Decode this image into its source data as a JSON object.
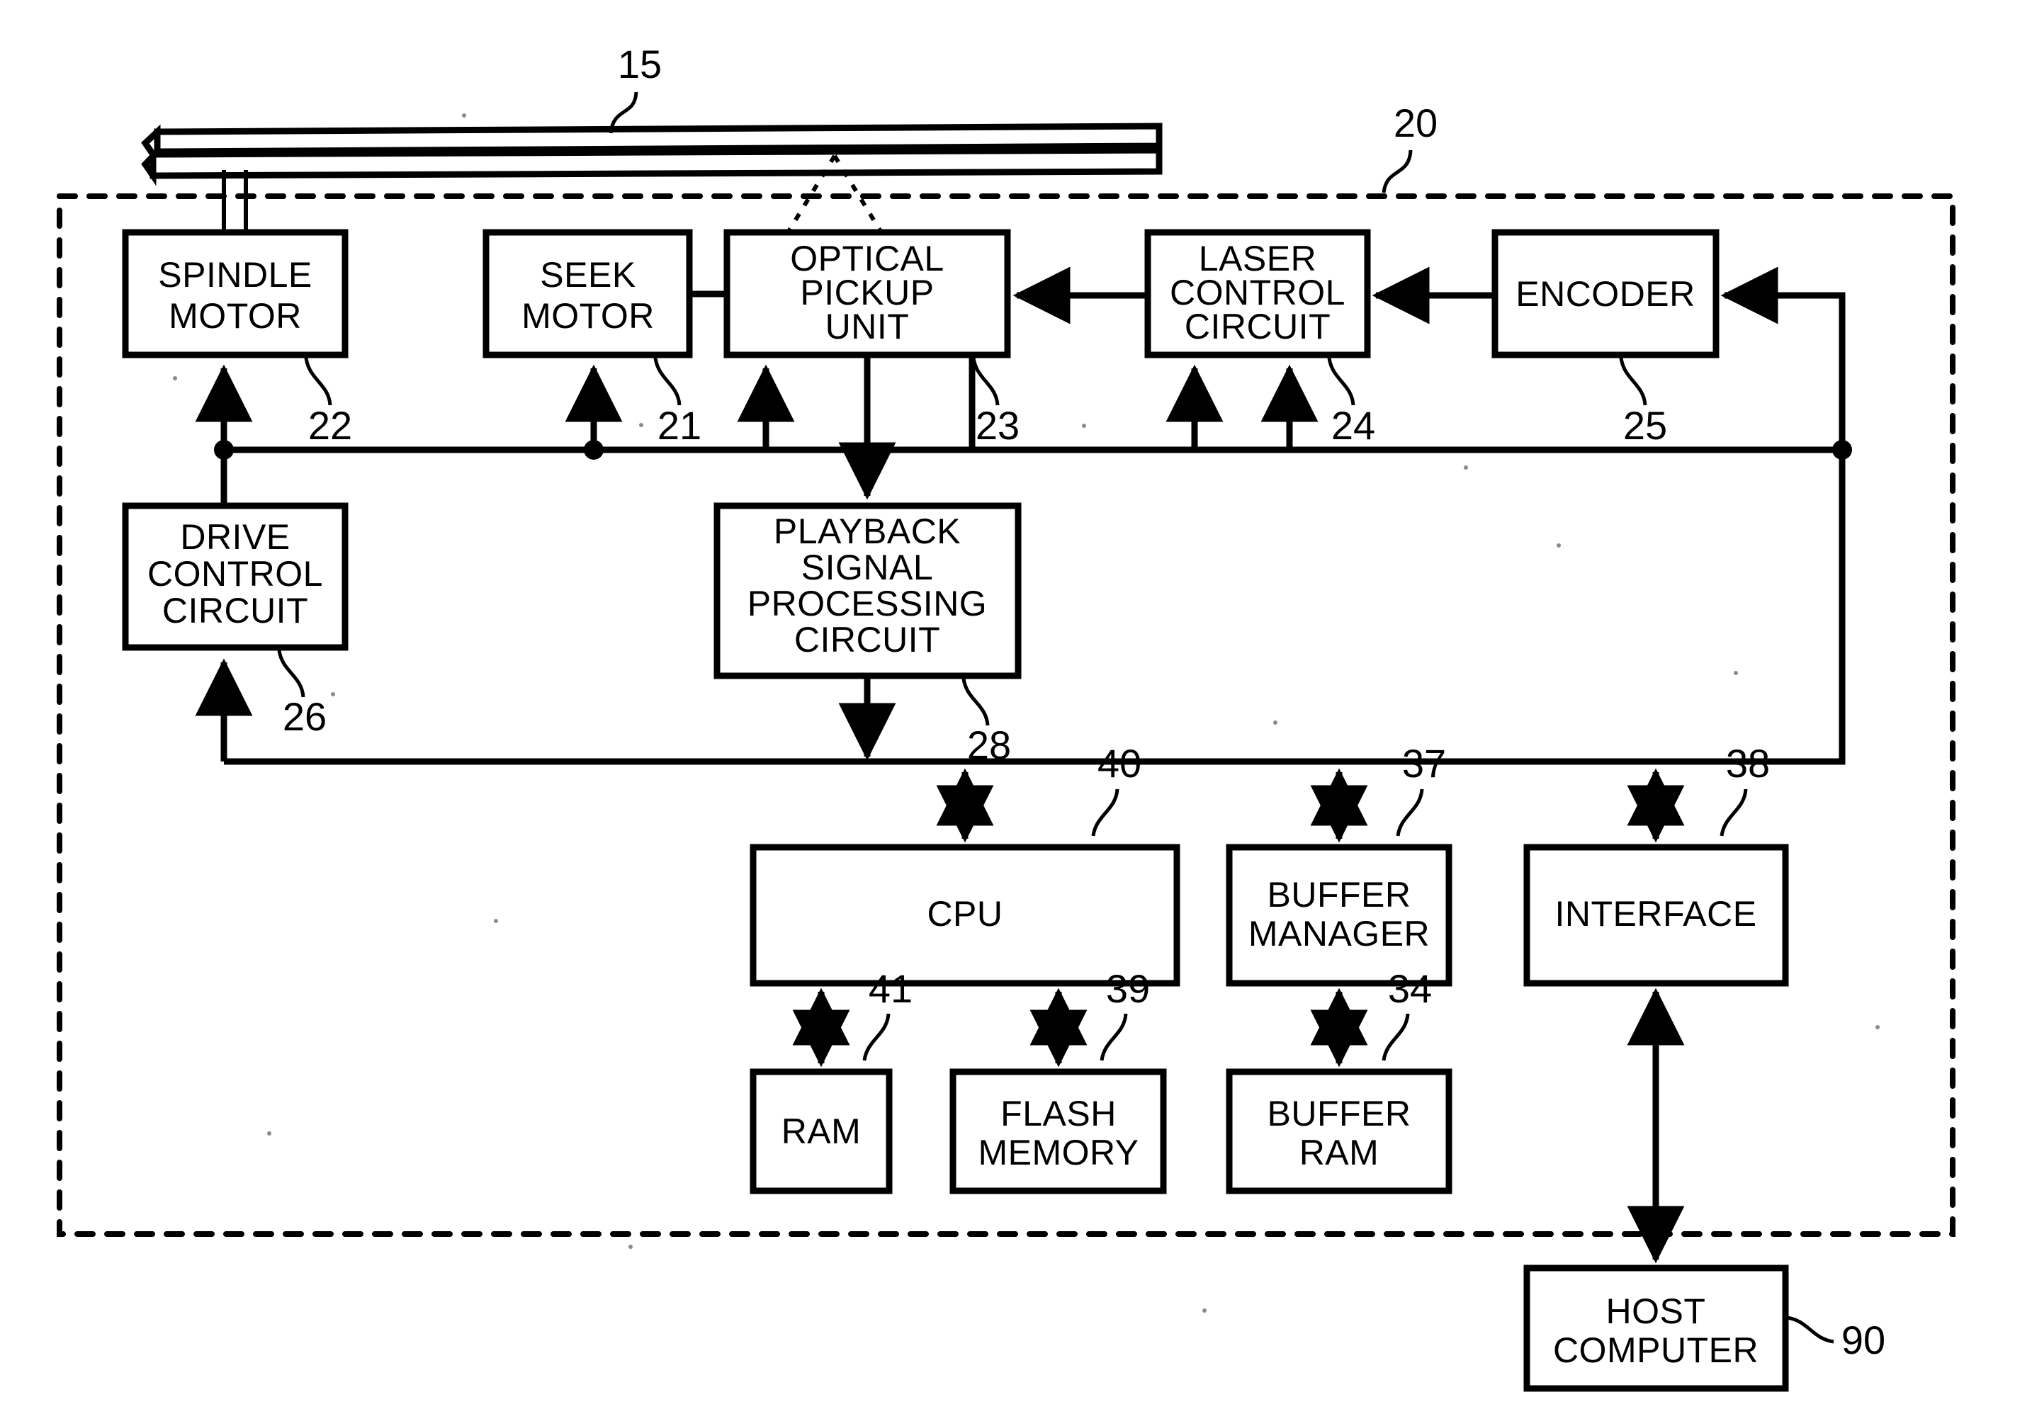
{
  "figure": {
    "type": "patent-block-diagram",
    "subject": "optical disc drive block diagram"
  },
  "blocks": [
    {
      "id": "spindle-motor",
      "lines": [
        "SPINDLE",
        "MOTOR"
      ],
      "ref": "22"
    },
    {
      "id": "seek-motor",
      "lines": [
        "SEEK",
        "MOTOR"
      ],
      "ref": "21"
    },
    {
      "id": "optical-pickup",
      "lines": [
        "OPTICAL",
        "PICKUP",
        "UNIT"
      ],
      "ref": "23"
    },
    {
      "id": "laser-control",
      "lines": [
        "LASER",
        "CONTROL",
        "CIRCUIT"
      ],
      "ref": "24"
    },
    {
      "id": "encoder",
      "lines": [
        "ENCODER"
      ],
      "ref": "25"
    },
    {
      "id": "drive-control",
      "lines": [
        "DRIVE",
        "CONTROL",
        "CIRCUIT"
      ],
      "ref": "26"
    },
    {
      "id": "playback",
      "lines": [
        "PLAYBACK",
        "SIGNAL",
        "PROCESSING",
        "CIRCUIT"
      ],
      "ref": "28"
    },
    {
      "id": "cpu",
      "lines": [
        "CPU"
      ],
      "ref": "40"
    },
    {
      "id": "buffer-manager",
      "lines": [
        "BUFFER",
        "MANAGER"
      ],
      "ref": "37"
    },
    {
      "id": "interface",
      "lines": [
        "INTERFACE"
      ],
      "ref": "38"
    },
    {
      "id": "ram",
      "lines": [
        "RAM"
      ],
      "ref": "41"
    },
    {
      "id": "flash-memory",
      "lines": [
        "FLASH",
        "MEMORY"
      ],
      "ref": "39"
    },
    {
      "id": "buffer-ram",
      "lines": [
        "BUFFER",
        "RAM"
      ],
      "ref": "34"
    },
    {
      "id": "host-computer",
      "lines": [
        "HOST",
        "COMPUTER"
      ],
      "ref": "90"
    }
  ],
  "labels": {
    "spindle_motor_l1": "SPINDLE",
    "spindle_motor_l2": "MOTOR",
    "seek_motor_l1": "SEEK",
    "seek_motor_l2": "MOTOR",
    "optical_pickup_l1": "OPTICAL",
    "optical_pickup_l2": "PICKUP",
    "optical_pickup_l3": "UNIT",
    "laser_control_l1": "LASER",
    "laser_control_l2": "CONTROL",
    "laser_control_l3": "CIRCUIT",
    "encoder_l1": "ENCODER",
    "drive_control_l1": "DRIVE",
    "drive_control_l2": "CONTROL",
    "drive_control_l3": "CIRCUIT",
    "playback_l1": "PLAYBACK",
    "playback_l2": "SIGNAL",
    "playback_l3": "PROCESSING",
    "playback_l4": "CIRCUIT",
    "cpu_l1": "CPU",
    "buffer_manager_l1": "BUFFER",
    "buffer_manager_l2": "MANAGER",
    "interface_l1": "INTERFACE",
    "ram_l1": "RAM",
    "flash_memory_l1": "FLASH",
    "flash_memory_l2": "MEMORY",
    "buffer_ram_l1": "BUFFER",
    "buffer_ram_l2": "RAM",
    "host_computer_l1": "HOST",
    "host_computer_l2": "COMPUTER"
  },
  "refs": {
    "disc": "15",
    "drive_unit": "20",
    "seek_motor": "21",
    "spindle_motor": "22",
    "optical_pickup": "23",
    "laser_control": "24",
    "encoder": "25",
    "drive_control": "26",
    "playback": "28",
    "buffer_ram": "34",
    "buffer_manager": "37",
    "interface": "38",
    "flash_memory": "39",
    "cpu": "40",
    "ram": "41",
    "host_computer": "90"
  },
  "colors": {
    "ink": "#000000",
    "paper": "#ffffff"
  }
}
